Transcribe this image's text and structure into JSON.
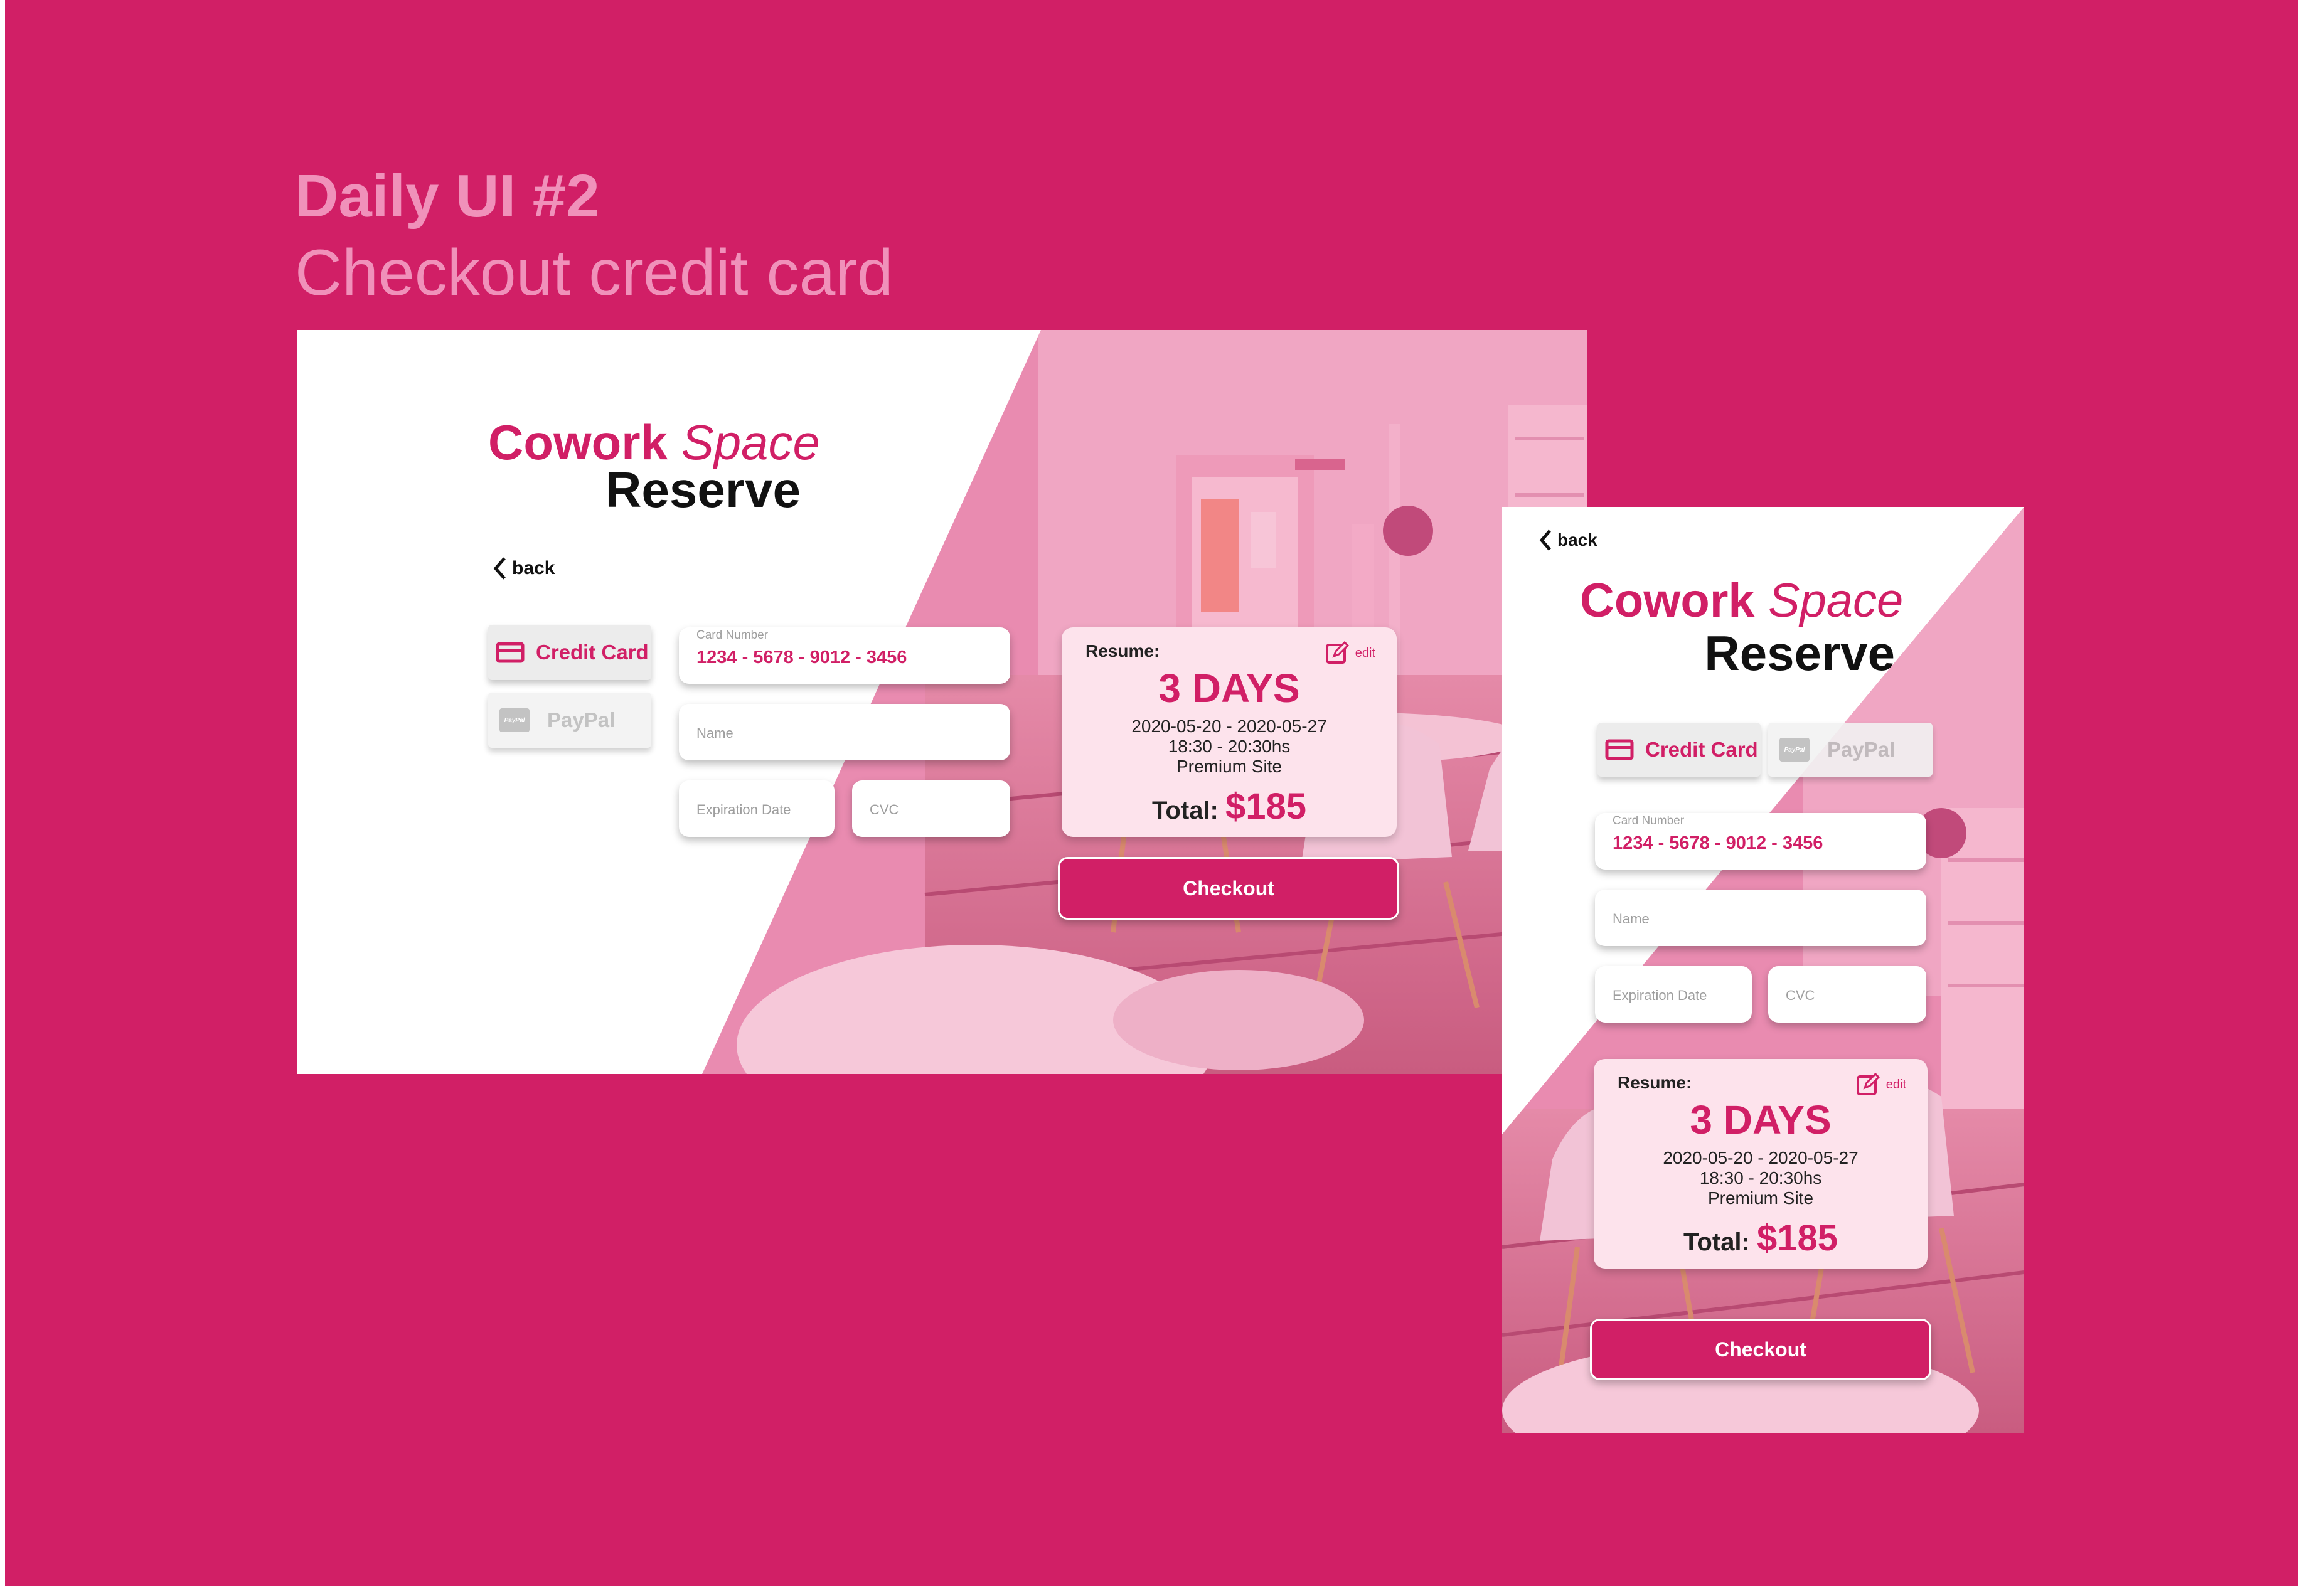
{
  "header": {
    "title": "Daily UI #2",
    "subtitle": "Checkout credit card"
  },
  "colors": {
    "background": "#d11f66",
    "accent": "#d11f66",
    "header_text": "#f091ba",
    "resume_bg": "#fde3ec"
  },
  "desktop": {
    "brand_bold": "Cowork",
    "brand_italic": "Space",
    "brand_second": "Reserve",
    "back_label": "back",
    "tabs": [
      {
        "label": "Credit Card",
        "icon": "credit-card-icon",
        "active": true
      },
      {
        "label": "PayPal",
        "icon": "paypal-icon",
        "active": false
      }
    ],
    "paypal_logo_text": "PayPal",
    "card_number_label": "Card Number",
    "card_number_value": "1234 - 5678 - 9012 - 3456",
    "name_placeholder": "Name",
    "expiration_placeholder": "Expiration Date",
    "cvc_placeholder": "CVC",
    "resume": {
      "label": "Resume:",
      "edit_label": "edit",
      "days": "3 DAYS",
      "dates": "2020-05-20  - 2020-05-27",
      "hours": "18:30 - 20:30hs",
      "site": "Premium Site",
      "total_label": "Total:",
      "total_value": "$185"
    },
    "checkout_label": "Checkout"
  },
  "mobile": {
    "brand_bold": "Cowork",
    "brand_italic": "Space",
    "brand_second": "Reserve",
    "back_label": "back",
    "tabs": [
      {
        "label": "Credit Card",
        "icon": "credit-card-icon",
        "active": true
      },
      {
        "label": "PayPal",
        "icon": "paypal-icon",
        "active": false
      }
    ],
    "paypal_logo_text": "PayPal",
    "card_number_label": "Card Number",
    "card_number_value": "1234 - 5678 - 9012 - 3456",
    "name_placeholder": "Name",
    "expiration_placeholder": "Expiration Date",
    "cvc_placeholder": "CVC",
    "resume": {
      "label": "Resume:",
      "edit_label": "edit",
      "days": "3 DAYS",
      "dates": "2020-05-20  - 2020-05-27",
      "hours": "18:30 - 20:30hs",
      "site": "Premium Site",
      "total_label": "Total:",
      "total_value": "$185"
    },
    "checkout_label": "Checkout"
  }
}
